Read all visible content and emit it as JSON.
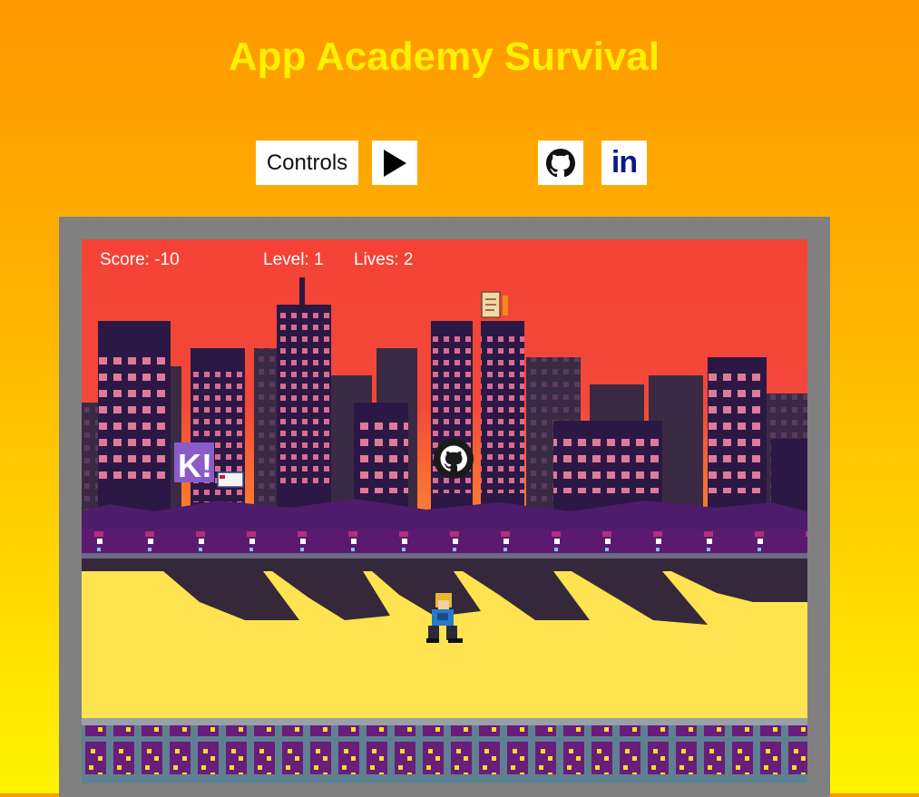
{
  "header": {
    "title": "App Academy Survival"
  },
  "toolbar": {
    "controls_label": "Controls",
    "play_icon": "play-icon",
    "github_icon": "github-icon",
    "linkedin_label": "in"
  },
  "hud": {
    "score": "Score: -10",
    "level": "Level: 1",
    "lives": "Lives: 2"
  },
  "colors": {
    "background_top": "#ff9800",
    "background_bottom": "#fff500",
    "title": "#fff000",
    "sky_top": "#f44236",
    "ground": "#ffe350",
    "frame": "#808080"
  }
}
